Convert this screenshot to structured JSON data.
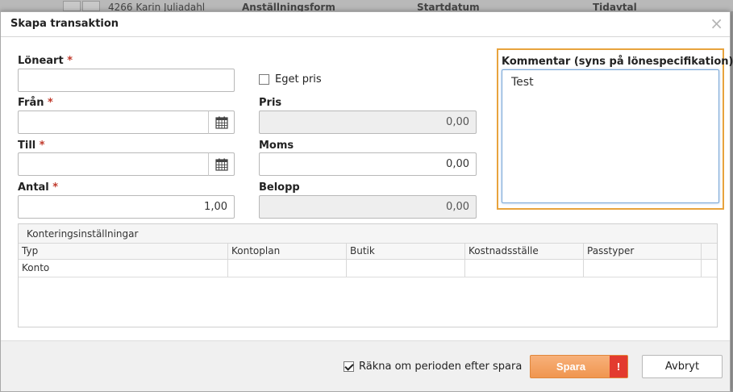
{
  "background": {
    "row_text": "4266 Karin Juliadahl",
    "col_anstallningsform": "Anställningsform",
    "col_startdatum": "Startdatum",
    "col_tidavtal": "Tidavtal"
  },
  "dialog": {
    "title": "Skapa transaktion",
    "close_glyph": "×"
  },
  "form": {
    "loneart": {
      "label": "Löneart",
      "required_mark": "*",
      "value": ""
    },
    "fran": {
      "label": "Från",
      "required_mark": "*",
      "value": ""
    },
    "till": {
      "label": "Till",
      "required_mark": "*",
      "value": ""
    },
    "antal": {
      "label": "Antal",
      "required_mark": "*",
      "value": "1,00"
    },
    "eget_pris": {
      "label": "Eget pris",
      "checked": false
    },
    "pris": {
      "label": "Pris",
      "value": "0,00"
    },
    "moms": {
      "label": "Moms",
      "value": "0,00"
    },
    "belopp": {
      "label": "Belopp",
      "value": "0,00"
    },
    "kommentar": {
      "label": "Kommentar (syns på lönespecifikation)",
      "value": "Test"
    }
  },
  "konto_grid": {
    "title": "Konteringsinställningar",
    "columns": [
      "Typ",
      "Kontoplan",
      "Butik",
      "Kostnadsställe",
      "Passtyper"
    ],
    "rows": [
      [
        "Konto",
        "",
        "",
        "",
        ""
      ]
    ]
  },
  "footer": {
    "recalc_label": "Räkna om perioden efter spara",
    "recalc_checked": true,
    "save_label": "Spara",
    "save_warning_glyph": "!",
    "cancel_label": "Avbryt"
  },
  "colors": {
    "accent_orange": "#f0964f",
    "focus_outline": "#e8a33d",
    "warning_red": "#e33b2f",
    "required_red": "#c0392b"
  },
  "icons": {
    "calendar": "calendar-icon",
    "close": "close-icon",
    "check": "check-icon",
    "warning": "exclamation-icon"
  }
}
